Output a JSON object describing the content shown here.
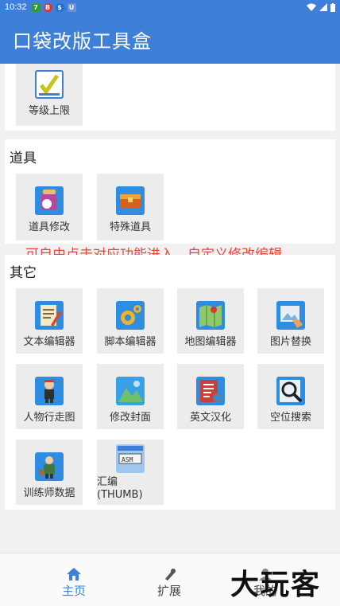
{
  "status_bar": {
    "time": "10:32",
    "badges": [
      "7",
      "B",
      "$",
      "U"
    ]
  },
  "app": {
    "title": "口袋改版工具盒"
  },
  "section_top": {
    "tiles": [
      {
        "label": "等级上限",
        "icon": "level-cap-icon"
      }
    ]
  },
  "section_items": {
    "title": "道具",
    "tiles": [
      {
        "label": "道具修改",
        "icon": "item-edit-icon"
      },
      {
        "label": "特殊道具",
        "icon": "special-item-icon"
      }
    ]
  },
  "overlay_text": "可自由点击对应功能进入，自定义修改编辑",
  "section_other": {
    "title": "其它",
    "tiles": [
      {
        "label": "文本编辑器",
        "icon": "text-editor-icon"
      },
      {
        "label": "脚本编辑器",
        "icon": "script-editor-icon"
      },
      {
        "label": "地图编辑器",
        "icon": "map-editor-icon"
      },
      {
        "label": "图片替换",
        "icon": "image-replace-icon"
      },
      {
        "label": "人物行走图",
        "icon": "character-walk-icon"
      },
      {
        "label": "修改封面",
        "icon": "cover-edit-icon"
      },
      {
        "label": "英文汉化",
        "icon": "translate-icon"
      },
      {
        "label": "空位搜索",
        "icon": "slot-search-icon"
      },
      {
        "label": "训练师数据",
        "icon": "trainer-data-icon"
      },
      {
        "label": "汇编\n(THUMB)",
        "icon": "asm-icon"
      }
    ]
  },
  "bottom_nav": {
    "items": [
      {
        "label": "主页",
        "active": true
      },
      {
        "label": "扩展",
        "active": false
      },
      {
        "label": "我的",
        "active": false
      }
    ]
  },
  "watermark": "大玩客",
  "colors": {
    "primary": "#3d7fd9",
    "overlay_red": "#e8453c",
    "active_nav": "#3d7fd9"
  }
}
